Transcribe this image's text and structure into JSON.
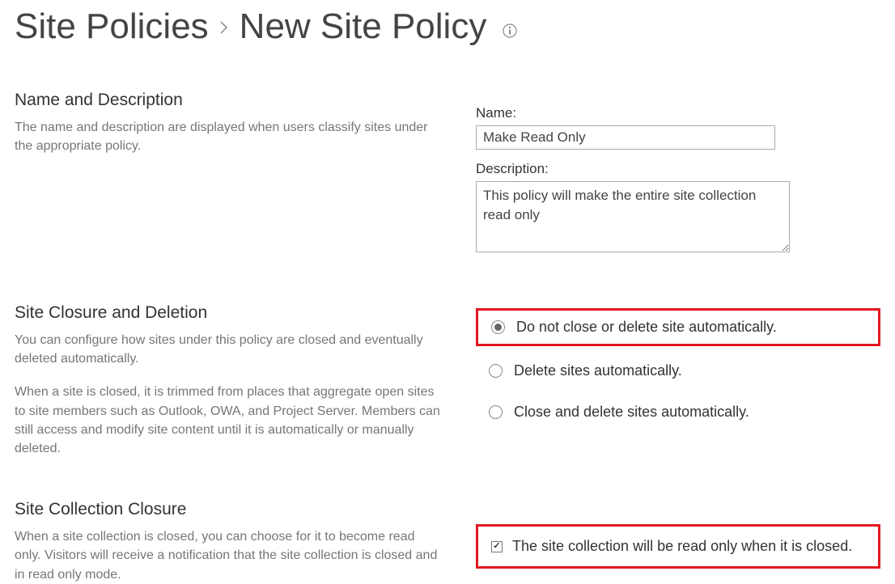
{
  "breadcrumb": {
    "parent": "Site Policies",
    "current": "New Site Policy"
  },
  "section_name_desc": {
    "heading": "Name and Description",
    "description": "The name and description are displayed when users classify sites under the appropriate policy.",
    "name_label": "Name:",
    "name_value": "Make Read Only",
    "desc_label": "Description:",
    "desc_value": "This policy will make the entire site collection read only"
  },
  "section_closure": {
    "heading": "Site Closure and Deletion",
    "description1": "You can configure how sites under this policy are closed and eventually deleted automatically.",
    "description2": "When a site is closed, it is trimmed from places that aggregate open sites to site members such as Outlook, OWA, and Project Server. Members can still access and modify site content until it is automatically or manually deleted.",
    "radio_options": [
      {
        "label": "Do not close or delete site automatically.",
        "checked": true,
        "highlighted": true
      },
      {
        "label": "Delete sites automatically.",
        "checked": false,
        "highlighted": false
      },
      {
        "label": "Close and delete sites automatically.",
        "checked": false,
        "highlighted": false
      }
    ]
  },
  "section_collection": {
    "heading": "Site Collection Closure",
    "description": "When a site collection is closed, you can choose for it to become read only. Visitors will receive a notification that the site collection is closed and in read only mode.",
    "checkbox_label": "The site collection will be read only when it is closed.",
    "checkbox_checked": true,
    "checkbox_highlighted": true
  }
}
